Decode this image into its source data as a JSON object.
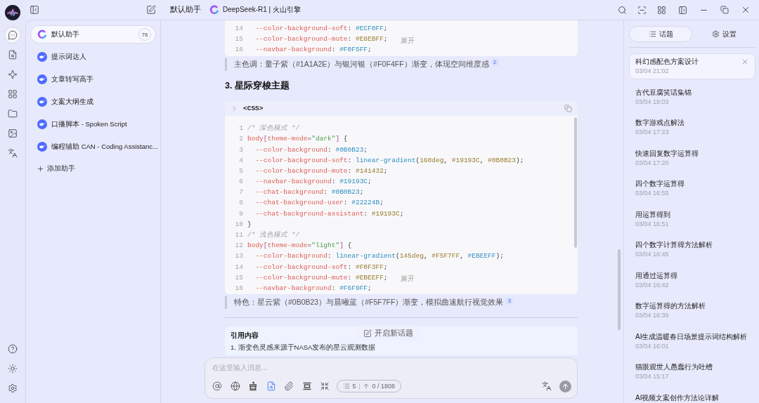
{
  "nav_rail": [
    {
      "kind": "chat",
      "selected": true
    },
    {
      "kind": "search",
      "selected": false
    },
    {
      "kind": "agents",
      "selected": false
    },
    {
      "kind": "apps",
      "selected": false
    },
    {
      "kind": "files",
      "selected": false
    },
    {
      "kind": "paintings",
      "selected": false
    },
    {
      "kind": "translate",
      "selected": false
    }
  ],
  "assistants": {
    "items": [
      {
        "name": "默认助手",
        "kind": "default",
        "selected": true,
        "count": "76"
      },
      {
        "name": "提示词达人",
        "kind": "agent",
        "selected": false
      },
      {
        "name": "文章转写高手",
        "kind": "agent",
        "selected": false
      },
      {
        "name": "文案大纲生成",
        "kind": "agent",
        "selected": false
      },
      {
        "name": "口播脚本 - Spoken Script",
        "kind": "agent",
        "selected": false
      },
      {
        "name": "编程辅助 CAN - Coding Assistanc...",
        "kind": "agent",
        "selected": false
      }
    ],
    "add_label": "添加助手"
  },
  "header": {
    "assistant": "默认助手",
    "model": "DeepSeek-R1 | 火山引擎"
  },
  "messages": [
    {
      "kind": "code",
      "expand": "展开",
      "lines": [
        {
          "n": "14",
          "tokens": [
            {
              "text": "  --color-background-soft",
              "kind": "prop"
            },
            {
              "text": ": ",
              "kind": "plain"
            },
            {
              "text": "#ECF0FF",
              "kind": "value"
            },
            {
              "text": ";",
              "kind": "plain"
            }
          ]
        },
        {
          "n": "15",
          "tokens": [
            {
              "text": "  --color-background-mute",
              "kind": "prop"
            },
            {
              "text": ": ",
              "kind": "plain"
            },
            {
              "text": "#E8EBFF",
              "kind": "number"
            },
            {
              "text": ";",
              "kind": "plain"
            }
          ]
        },
        {
          "n": "16",
          "tokens": [
            {
              "text": "  --navbar-background",
              "kind": "prop"
            },
            {
              "text": ": ",
              "kind": "plain"
            },
            {
              "text": "#F0F5FF",
              "kind": "value"
            },
            {
              "text": ";",
              "kind": "plain"
            }
          ]
        }
      ]
    },
    {
      "kind": "quote",
      "text": "主色调：量子紫（#1A1A2E）与银河银（#F0F4FF）渐变，体现空间维度感",
      "citation": "2"
    },
    {
      "kind": "heading",
      "text": "3. 星际穿梭主题"
    },
    {
      "kind": "code",
      "language": "<CSS>",
      "expand": "展开",
      "lines": [
        {
          "n": "1",
          "tokens": [
            {
              "text": "/* 深色模式 */",
              "kind": "comment"
            }
          ]
        },
        {
          "n": "2",
          "tokens": [
            {
              "text": "body",
              "kind": "tag"
            },
            {
              "text": "[",
              "kind": "bracket"
            },
            {
              "text": "theme-mode",
              "kind": "attr"
            },
            {
              "text": "=",
              "kind": "plain"
            },
            {
              "text": "\"dark\"",
              "kind": "string"
            },
            {
              "text": "]",
              "kind": "bracket"
            },
            {
              "text": " {",
              "kind": "plain"
            }
          ]
        },
        {
          "n": "3",
          "tokens": [
            {
              "text": "  --color-background",
              "kind": "prop"
            },
            {
              "text": ": ",
              "kind": "plain"
            },
            {
              "text": "#0B0B23",
              "kind": "value"
            },
            {
              "text": ";",
              "kind": "plain"
            }
          ]
        },
        {
          "n": "4",
          "tokens": [
            {
              "text": "  --color-background-soft",
              "kind": "prop"
            },
            {
              "text": ": ",
              "kind": "plain"
            },
            {
              "text": "linear-gradient",
              "kind": "func"
            },
            {
              "text": "(",
              "kind": "plain"
            },
            {
              "text": "160deg",
              "kind": "number"
            },
            {
              "text": ", ",
              "kind": "plain"
            },
            {
              "text": "#19193C",
              "kind": "number"
            },
            {
              "text": ", ",
              "kind": "plain"
            },
            {
              "text": "#0B0B23",
              "kind": "number"
            },
            {
              "text": ");",
              "kind": "plain"
            }
          ]
        },
        {
          "n": "5",
          "tokens": [
            {
              "text": "  --color-background-mute",
              "kind": "prop"
            },
            {
              "text": ": ",
              "kind": "plain"
            },
            {
              "text": "#141432",
              "kind": "number"
            },
            {
              "text": ";",
              "kind": "plain"
            }
          ]
        },
        {
          "n": "6",
          "tokens": [
            {
              "text": "  --navbar-background",
              "kind": "prop"
            },
            {
              "text": ": ",
              "kind": "plain"
            },
            {
              "text": "#19193C",
              "kind": "value"
            },
            {
              "text": ";",
              "kind": "plain"
            }
          ]
        },
        {
          "n": "7",
          "tokens": [
            {
              "text": "  --chat-background",
              "kind": "prop"
            },
            {
              "text": ": ",
              "kind": "plain"
            },
            {
              "text": "#0B0B23",
              "kind": "value"
            },
            {
              "text": ";",
              "kind": "plain"
            }
          ]
        },
        {
          "n": "8",
          "tokens": [
            {
              "text": "  --chat-background-user",
              "kind": "prop"
            },
            {
              "text": ": ",
              "kind": "plain"
            },
            {
              "text": "#22224B",
              "kind": "value"
            },
            {
              "text": ";",
              "kind": "plain"
            }
          ]
        },
        {
          "n": "9",
          "tokens": [
            {
              "text": "  --chat-background-assistant",
              "kind": "prop"
            },
            {
              "text": ": ",
              "kind": "plain"
            },
            {
              "text": "#19193C",
              "kind": "number"
            },
            {
              "text": ";",
              "kind": "plain"
            }
          ]
        },
        {
          "n": "10",
          "tokens": [
            {
              "text": "}",
              "kind": "plain"
            }
          ]
        },
        {
          "n": "11",
          "tokens": [
            {
              "text": "/* 浅色模式 */",
              "kind": "comment"
            }
          ]
        },
        {
          "n": "12",
          "tokens": [
            {
              "text": "body",
              "kind": "tag"
            },
            {
              "text": "[",
              "kind": "bracket"
            },
            {
              "text": "theme-mode",
              "kind": "attr"
            },
            {
              "text": "=",
              "kind": "plain"
            },
            {
              "text": "\"light\"",
              "kind": "string"
            },
            {
              "text": "]",
              "kind": "bracket"
            },
            {
              "text": " {",
              "kind": "plain"
            }
          ]
        },
        {
          "n": "13",
          "tokens": [
            {
              "text": "  --color-background",
              "kind": "prop"
            },
            {
              "text": ": ",
              "kind": "plain"
            },
            {
              "text": "linear-gradient",
              "kind": "func"
            },
            {
              "text": "(",
              "kind": "plain"
            },
            {
              "text": "145deg",
              "kind": "number"
            },
            {
              "text": ", ",
              "kind": "plain"
            },
            {
              "text": "#F5F7FF",
              "kind": "number"
            },
            {
              "text": ", ",
              "kind": "plain"
            },
            {
              "text": "#EBEEFF",
              "kind": "value"
            },
            {
              "text": ");",
              "kind": "plain"
            }
          ]
        },
        {
          "n": "14",
          "tokens": [
            {
              "text": "  --color-background-soft",
              "kind": "prop"
            },
            {
              "text": ": ",
              "kind": "plain"
            },
            {
              "text": "#F0F3FF",
              "kind": "number"
            },
            {
              "text": ";",
              "kind": "plain"
            }
          ]
        },
        {
          "n": "15",
          "tokens": [
            {
              "text": "  --color-background-mute",
              "kind": "prop"
            },
            {
              "text": ": ",
              "kind": "plain"
            },
            {
              "text": "#EBEEFF",
              "kind": "number"
            },
            {
              "text": ";",
              "kind": "plain"
            }
          ]
        },
        {
          "n": "16",
          "tokens": [
            {
              "text": "  --navbar-background",
              "kind": "prop"
            },
            {
              "text": ": ",
              "kind": "plain"
            },
            {
              "text": "#F6F9FF",
              "kind": "value"
            },
            {
              "text": ";",
              "kind": "plain"
            }
          ]
        }
      ]
    },
    {
      "kind": "quote",
      "text": "特色：星云紫（#0B0B23）与晨曦蓝（#F5F7FF）渐变，模拟曲速航行视觉效果",
      "citation": "3"
    },
    {
      "kind": "divider"
    },
    {
      "kind": "citations",
      "title": "引用内容",
      "items": [
        "1. 渐变色灵感来源于NASA发布的星云观测数据"
      ]
    }
  ],
  "new_topic_button": "开启新话题",
  "input": {
    "placeholder": "在这里输入消息...",
    "tools": [
      {
        "kind": "mention",
        "active": false
      },
      {
        "kind": "web",
        "active": false
      },
      {
        "kind": "clear",
        "active": false
      },
      {
        "kind": "knowledge",
        "active": true
      },
      {
        "kind": "attach",
        "active": false
      },
      {
        "kind": "fold",
        "active": false
      },
      {
        "kind": "collapse",
        "active": false
      }
    ],
    "context_count": "5",
    "token_count": "0 / 1808"
  },
  "side_tabs": [
    {
      "label": "话题",
      "selected": true
    },
    {
      "label": "设置",
      "selected": false
    }
  ],
  "topics": [
    {
      "title": "科幻感配色方案设计",
      "time": "03/04 21:02",
      "selected": true
    },
    {
      "title": "古代豆腐笑话集锦",
      "time": "03/04 19:03",
      "selected": false
    },
    {
      "title": "数字游戏点解法",
      "time": "03/04 17:23",
      "selected": false
    },
    {
      "title": "快速回复数字运算得",
      "time": "03/04 17:20",
      "selected": false
    },
    {
      "title": "四个数字运算得",
      "time": "03/04 16:55",
      "selected": false
    },
    {
      "title": "用运算得到",
      "time": "03/04 16:51",
      "selected": false
    },
    {
      "title": "四个数字计算得方法解析",
      "time": "03/04 16:45",
      "selected": false
    },
    {
      "title": "用通过运算得",
      "time": "03/04 16:42",
      "selected": false
    },
    {
      "title": "数字运算得的方法解析",
      "time": "03/04 16:39",
      "selected": false
    },
    {
      "title": "AI生成温暖春日场景提示词结构解析",
      "time": "03/04 16:01",
      "selected": false
    },
    {
      "title": "猫眼观世人愚蠢行为吐槽",
      "time": "03/04 15:17",
      "selected": false
    },
    {
      "title": "AI视频文案创作方法论详解",
      "selected": false
    }
  ]
}
